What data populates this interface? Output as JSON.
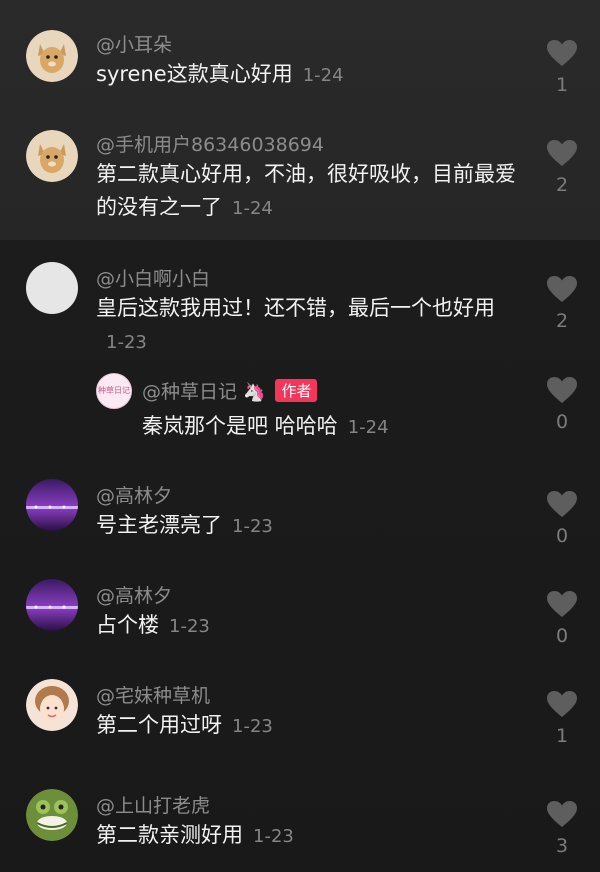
{
  "comments": [
    {
      "user": "@小耳朵",
      "text": "syrene这款真心好用",
      "date": "1-24",
      "likes": "1",
      "avatar": "dog-avatar"
    },
    {
      "user": "@手机用户86346038694",
      "text": "第二款真心好用，不油，很好吸收，目前最爱的没有之一了",
      "date": "1-24",
      "likes": "2",
      "avatar": "dog-avatar"
    },
    {
      "user": "@小白啊小白",
      "text": "皇后这款我用过！还不错，最后一个也好用",
      "date": "1-23",
      "likes": "2",
      "avatar": "blank-avatar"
    },
    {
      "user": "@种草日记",
      "badge": "作者",
      "avatar_text": "种草日记",
      "text": "秦岚那个是吧 哈哈哈",
      "date": "1-24",
      "likes": "0",
      "avatar": "logo-avatar",
      "emoji": "🦄"
    },
    {
      "user": "@高林夕",
      "text": "号主老漂亮了",
      "date": "1-23",
      "likes": "0",
      "avatar": "night-avatar"
    },
    {
      "user": "@高林夕",
      "text": "占个楼",
      "date": "1-23",
      "likes": "0",
      "avatar": "night-avatar"
    },
    {
      "user": "@宅妹种草机",
      "text": "第二个用过呀",
      "date": "1-23",
      "likes": "1",
      "avatar": "girl-avatar"
    },
    {
      "user": "@上山打老虎",
      "text": "第二款亲测好用",
      "date": "1-23",
      "likes": "3",
      "avatar": "frog-avatar"
    }
  ],
  "colors": {
    "like_icon": "#5e5e5e",
    "badge": "#f5365c"
  }
}
